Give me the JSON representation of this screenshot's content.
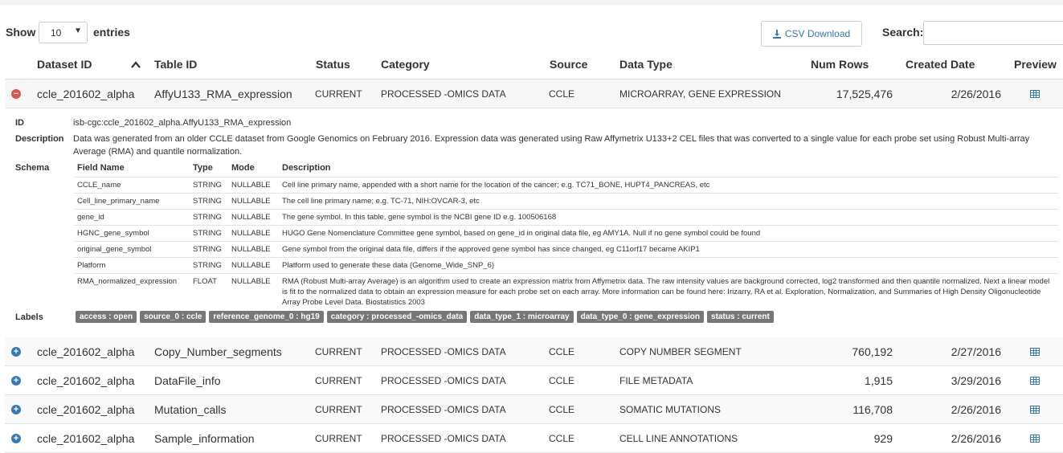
{
  "controls": {
    "show_label": "Show",
    "entries_value": "10",
    "entries_label": "entries",
    "csv_label": "CSV Download",
    "search_label": "Search:",
    "search_value": ""
  },
  "columns": {
    "dataset_id": "Dataset ID",
    "table_id": "Table ID",
    "status": "Status",
    "category": "Category",
    "source": "Source",
    "data_type": "Data Type",
    "num_rows": "Num Rows",
    "created_date": "Created Date",
    "preview": "Preview"
  },
  "rows": [
    {
      "dataset": "ccle_201602_alpha",
      "table": "AffyU133_RMA_expression",
      "status": "CURRENT",
      "category": "PROCESSED -OMICS DATA",
      "source": "CCLE",
      "data_type": "MICROARRAY, GENE EXPRESSION",
      "num_rows": "17,525,476",
      "created": "2/26/2016"
    },
    {
      "dataset": "ccle_201602_alpha",
      "table": "Copy_Number_segments",
      "status": "CURRENT",
      "category": "PROCESSED -OMICS DATA",
      "source": "CCLE",
      "data_type": "COPY NUMBER SEGMENT",
      "num_rows": "760,192",
      "created": "2/27/2016"
    },
    {
      "dataset": "ccle_201602_alpha",
      "table": "DataFile_info",
      "status": "CURRENT",
      "category": "PROCESSED -OMICS DATA",
      "source": "CCLE",
      "data_type": "FILE METADATA",
      "num_rows": "1,915",
      "created": "3/29/2016"
    },
    {
      "dataset": "ccle_201602_alpha",
      "table": "Mutation_calls",
      "status": "CURRENT",
      "category": "PROCESSED -OMICS DATA",
      "source": "CCLE",
      "data_type": "SOMATIC MUTATIONS",
      "num_rows": "116,708",
      "created": "2/26/2016"
    },
    {
      "dataset": "ccle_201602_alpha",
      "table": "Sample_information",
      "status": "CURRENT",
      "category": "PROCESSED -OMICS DATA",
      "source": "CCLE",
      "data_type": "CELL LINE ANNOTATIONS",
      "num_rows": "929",
      "created": "2/26/2016"
    }
  ],
  "detail": {
    "id_label": "ID",
    "id_value": "isb-cgc:ccle_201602_alpha.AffyU133_RMA_expression",
    "description_label": "Description",
    "description_value": "Data was generated from an older CCLE dataset from Google Genomics on February 2016. Expression data was generated using Raw Affymetrix U133+2 CEL files that was converted to a single value for each probe set using Robust Multi-array Average (RMA) and quantile normalization.",
    "schema_label": "Schema",
    "schema_headers": {
      "field": "Field Name",
      "type": "Type",
      "mode": "Mode",
      "description": "Description"
    },
    "schema_rows": [
      {
        "field": "CCLE_name",
        "type": "STRING",
        "mode": "NULLABLE",
        "description": "Cell line primary name, appended with a short name for the location of the cancer; e.g. TC71_BONE, HUPT4_PANCREAS, etc"
      },
      {
        "field": "Cell_line_primary_name",
        "type": "STRING",
        "mode": "NULLABLE",
        "description": "The cell line primary name; e.g. TC-71, NIH:OVCAR-3, etc"
      },
      {
        "field": "gene_id",
        "type": "STRING",
        "mode": "NULLABLE",
        "description": "The gene symbol. In this table, gene symbol is the NCBI gene ID e.g. 100506168"
      },
      {
        "field": "HGNC_gene_symbol",
        "type": "STRING",
        "mode": "NULLABLE",
        "description": "HUGO Gene Nomenclature Committee gene symbol, based on gene_id in original data file, eg AMY1A. Null if no gene symbol could be found"
      },
      {
        "field": "original_gene_symbol",
        "type": "STRING",
        "mode": "NULLABLE",
        "description": "Gene symbol from the original data file, differs if the approved gene symbol has since changed, eg C11orf17 became AKIP1"
      },
      {
        "field": "Platform",
        "type": "STRING",
        "mode": "NULLABLE",
        "description": "Platform used to generate these data (Genome_Wide_SNP_6)"
      },
      {
        "field": "RMA_normalized_expression",
        "type": "FLOAT",
        "mode": "NULLABLE",
        "description": "RMA (Robust Multi-array Average) is an algorithm used to create an expression matrix from Affymetrix data. The raw intensity values are background corrected, log2 transformed and then quantile normalized. Next a linear model is fit to the normalized data to obtain an expression measure for each probe set on each array. More information can be found here: Irizarry, RA et al. Exploration, Normalization, and Summaries of High Density Oligonucleotide Array Probe Level Data. Biostatistics 2003"
      }
    ],
    "labels_label": "Labels",
    "labels": [
      "access : open",
      "source_0 : ccle",
      "reference_genome_0 : hg19",
      "category : processed_-omics_data",
      "data_type_1 : microarray",
      "data_type_0 : gene_expression",
      "status : current"
    ]
  }
}
